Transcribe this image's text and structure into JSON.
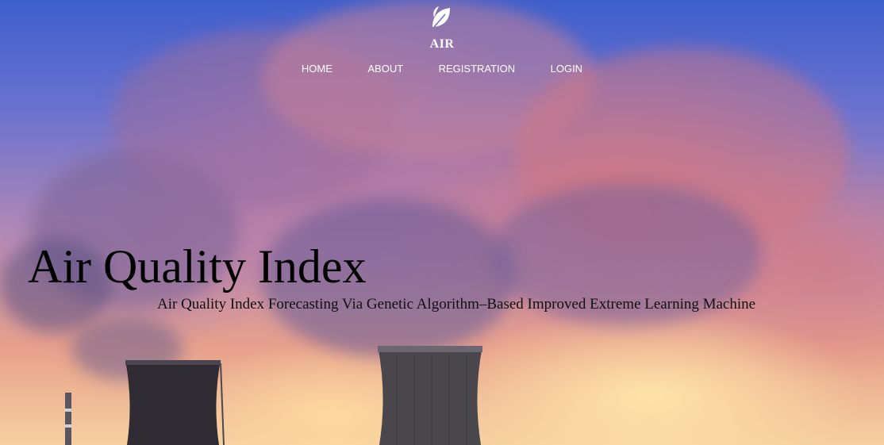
{
  "brand": {
    "name": "AIR",
    "icon": "leaf-icon"
  },
  "nav": {
    "items": [
      {
        "label": "HOME"
      },
      {
        "label": "ABOUT"
      },
      {
        "label": "REGISTRATION"
      },
      {
        "label": "LOGIN"
      }
    ]
  },
  "hero": {
    "title": "Air Quality Index",
    "subtitle": "Air Quality Index Forecasting Via Genetic Algorithm–Based Improved Extreme Learning Machine",
    "background": "smoke-plumes-over-cooling-towers-at-sunset"
  },
  "colors": {
    "sky_top": "#3e5fcc",
    "smoke": "#b77fa3",
    "glow": "#f6d0a0",
    "nav_text": "#ffffff",
    "title_text": "#000000"
  }
}
